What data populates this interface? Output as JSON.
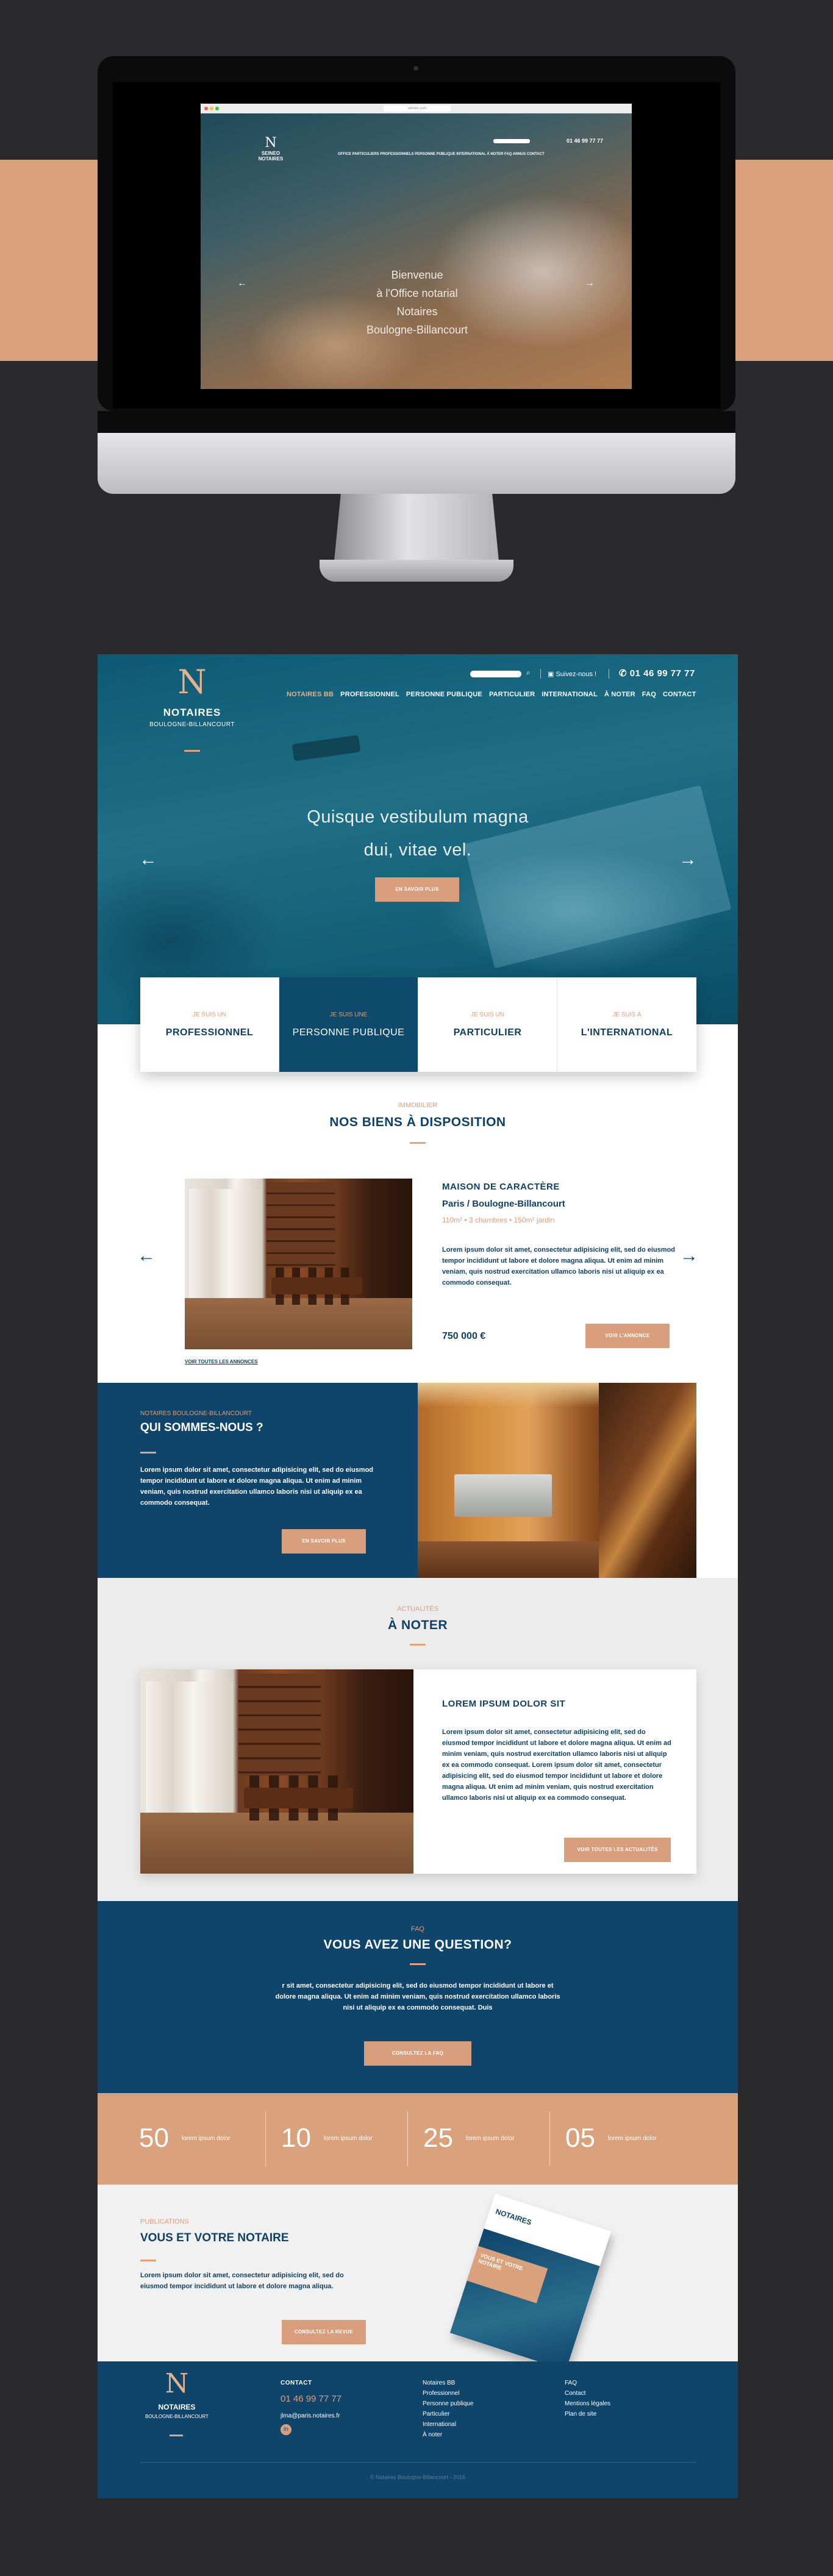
{
  "desktop_preview": {
    "url": "seineo.com",
    "logo_top": "SEINEO",
    "logo_bottom": "NOTAIRES",
    "phone": "01 46 99 77 77",
    "nav": "OFFICE   PARTICULIERS   PROFESSIONNELS   PERSONNE PUBLIQUE   INTERNATIONAL   À NOTER   FAQ   ANNUS   CONTACT",
    "hero_line1": "Bienvenue",
    "hero_line2": "à l'Office notarial",
    "hero_line3": "Notaires",
    "hero_line4": "Boulogne-Billancourt"
  },
  "site": {
    "logo": {
      "mark": "N",
      "title": "NOTAIRES",
      "subtitle": "BOULOGNE-BILLANCOURT"
    },
    "topbar": {
      "link": "Suivez-nous !",
      "phone": "01 46 99 77 77"
    },
    "nav": [
      "NOTAIRES BB",
      "PROFESSIONNEL",
      "PERSONNE PUBLIQUE",
      "PARTICULIER",
      "INTERNATIONAL",
      "À NOTER",
      "FAQ",
      "CONTACT"
    ],
    "hero": {
      "line1": "Quisque vestibulum magna",
      "line2": "dui, vitae vel.",
      "button": "EN SAVOIR PLUS"
    },
    "cards": [
      {
        "small": "JE SUIS UN",
        "big": "PROFESSIONNEL"
      },
      {
        "small": "JE SUIS UNE",
        "big": "PERSONNE PUBLIQUE"
      },
      {
        "small": "JE SUIS UN",
        "big": "PARTICULIER"
      },
      {
        "small": "JE SUIS À",
        "big": "L'INTERNATIONAL"
      }
    ],
    "listings": {
      "kicker": "IMMOBILIER",
      "title": "NOS BIENS À DISPOSITION",
      "property_title": "MAISON DE CARACTÈRE",
      "property_location": "Paris / Boulogne-Billancourt",
      "property_features": "110m²  •  3 chambres  •  150m² jardin",
      "property_desc": "Lorem ipsum dolor sit amet, consectetur adipisicing elit, sed do eiusmod tempor incididunt ut labore et dolore magna aliqua. Ut enim ad minim veniam, quis nostrud exercitation ullamco laboris nisi ut aliquip ex ea commodo consequat.",
      "price": "750 000 €",
      "button": "VOIR L'ANNONCE",
      "all_link": "VOIR TOUTES LES ANNONCES"
    },
    "who": {
      "kicker": "NOTAIRES BOULOGNE-BILLANCOURT",
      "title": "QUI SOMMES-NOUS ?",
      "text": "Lorem ipsum dolor sit amet, consectetur adipisicing elit, sed do eiusmod tempor incididunt ut labore et dolore magna aliqua. Ut enim ad minim veniam, quis nostrud exercitation ullamco laboris nisi ut aliquip ex ea commodo consequat.",
      "button": "EN SAVOIR PLUS"
    },
    "notes": {
      "kicker": "ACTUALITÉS",
      "title": "À NOTER",
      "card_title": "LOREM IPSUM DOLOR SIT",
      "card_text": "Lorem ipsum dolor sit amet, consectetur adipisicing elit, sed do eiusmod tempor incididunt ut labore et dolore magna aliqua. Ut enim ad minim veniam, quis nostrud exercitation ullamco laboris nisi ut aliquip ex ea commodo consequat. Lorem ipsum dolor sit amet, consectetur adipisicing elit, sed do eiusmod tempor incididunt ut labore et dolore magna aliqua. Ut enim ad minim veniam, quis nostrud exercitation ullamco laboris nisi ut aliquip ex ea commodo consequat.",
      "button": "VOIR TOUTES LES ACTUALITÉS"
    },
    "faq": {
      "kicker": "FAQ",
      "title": "VOUS AVEZ UNE QUESTION?",
      "text": "r sit amet, consectetur adipisicing elit, sed do eiusmod tempor incididunt ut labore et dolore magna aliqua. Ut enim ad minim veniam, quis nostrud exercitation ullamco laboris nisi ut aliquip ex ea commodo consequat. Duis",
      "button": "CONSULTEZ LA FAQ"
    },
    "stats": [
      {
        "num": "50",
        "label": "lorem ipsum dolor"
      },
      {
        "num": "10",
        "label": "lorem ipsum dolor"
      },
      {
        "num": "25",
        "label": "lorem ipsum dolor"
      },
      {
        "num": "05",
        "label": "lorem ipsum dolor"
      }
    ],
    "pubs": {
      "kicker": "PUBLICATIONS",
      "title": "VOUS ET VOTRE NOTAIRE",
      "text": "Lorem ipsum dolor sit amet, consectetur adipisicing elit, sed do eiusmod tempor incididunt ut labore et dolore magna aliqua.",
      "button": "CONSULTEZ LA REVUE",
      "magazine_title": "NOTAIRES",
      "magazine_band": "VOUS ET VOTRE NOTAIRE"
    },
    "footer": {
      "contact_head": "CONTACT",
      "phone": "01 46 99 77 77",
      "email": "jlma@paris.notaires.fr",
      "col1": [
        "Notaires BB",
        "Professionnel",
        "Personne publique",
        "Particulier",
        "International",
        "À noter"
      ],
      "col2": [
        "FAQ",
        "Contact",
        "Mentions légales",
        "Plan de site"
      ],
      "copyright": "© Notaires Boulogne-Billancourt - 2016"
    }
  },
  "colors": {
    "navy": "#0f446b",
    "accent": "#d99f7c",
    "background": "#2a292c"
  }
}
